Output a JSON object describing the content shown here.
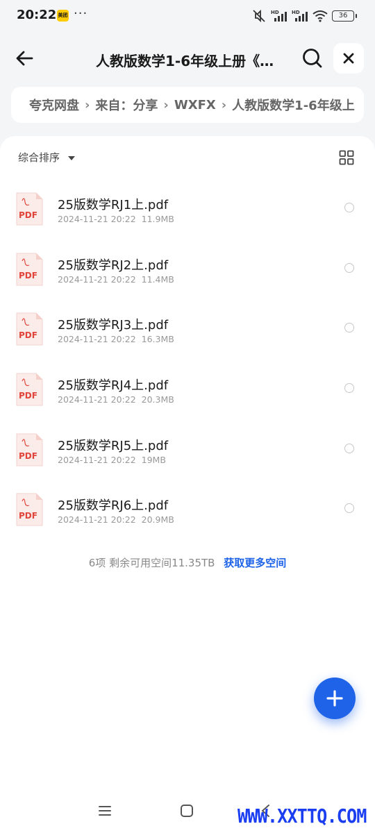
{
  "status_bar": {
    "time": "20:22",
    "app_badge": "美团",
    "battery": "36",
    "icons": [
      "mute-icon",
      "signal-hd-icon",
      "signal-hd-icon",
      "wifi-icon",
      "battery-icon"
    ]
  },
  "header": {
    "title": "人教版数学1-6年级上册《…",
    "back_icon": "arrow-left-icon",
    "search_icon": "search-icon",
    "close_icon": "close-icon"
  },
  "breadcrumb": {
    "items": [
      "夸克网盘",
      "来自：分享",
      "WXFX",
      "人教版数学1-6年级上"
    ]
  },
  "toolbar": {
    "sort_label": "综合排序",
    "view_icon": "grid-view-icon"
  },
  "files": [
    {
      "icon": "PDF",
      "name": "25版数学RJ1上.pdf",
      "date": "2024-11-21 20:22",
      "size": "11.9MB"
    },
    {
      "icon": "PDF",
      "name": "25版数学RJ2上.pdf",
      "date": "2024-11-21 20:22",
      "size": "11.4MB"
    },
    {
      "icon": "PDF",
      "name": "25版数学RJ3上.pdf",
      "date": "2024-11-21 20:22",
      "size": "16.3MB"
    },
    {
      "icon": "PDF",
      "name": "25版数学RJ4上.pdf",
      "date": "2024-11-21 20:22",
      "size": "20.3MB"
    },
    {
      "icon": "PDF",
      "name": "25版数学RJ5上.pdf",
      "date": "2024-11-21 20:22",
      "size": "19MB"
    },
    {
      "icon": "PDF",
      "name": "25版数学RJ6上.pdf",
      "date": "2024-11-21 20:22",
      "size": "20.9MB"
    }
  ],
  "footer": {
    "count": "6项",
    "space": "剩余可用空间11.35TB",
    "link": "获取更多空间"
  },
  "fab": {
    "icon": "plus-icon"
  },
  "watermark": "WWW.XXTTQ.COM",
  "colors": {
    "accent": "#1e63e8",
    "pdf_red": "#e0443a",
    "background": "#f4f5f7"
  }
}
